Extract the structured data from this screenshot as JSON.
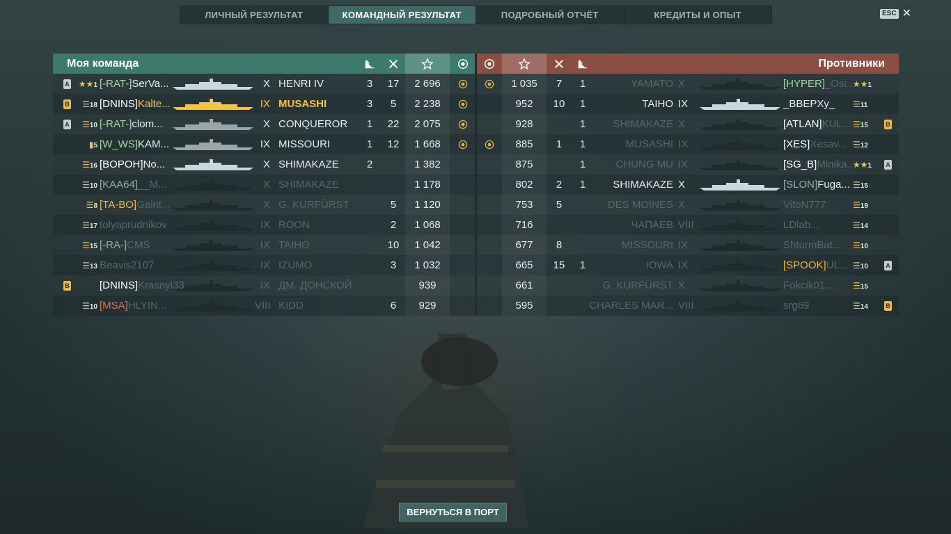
{
  "tabs": [
    {
      "label": "ЛИЧНЫЙ РЕЗУЛЬТАТ",
      "active": false
    },
    {
      "label": "КОМАНДНЫЙ РЕЗУЛЬТАТ",
      "active": true
    },
    {
      "label": "ПОДРОБНЫЙ ОТЧЁТ",
      "active": false
    },
    {
      "label": "КРЕДИТЫ И ОПЫТ",
      "active": false
    }
  ],
  "esc": {
    "key": "ESC",
    "close": "✕"
  },
  "my_team": {
    "title": "Моя команда",
    "rows": [
      {
        "badge": "A",
        "rank": "1",
        "rank_icon": "stars",
        "clan": "[-RAT-]",
        "clan_color": "green",
        "name": "SerVa...",
        "tier": "X",
        "ship": "HENRI IV",
        "kills": "3",
        "planes": "17",
        "xp": "2 696",
        "medal": true,
        "dim": false,
        "sil": "light",
        "hl": false
      },
      {
        "badge": "B",
        "rank": "18",
        "rank_icon": "chevron",
        "clan": "[DNINS]",
        "clan_color": "white",
        "name": "Kalte...",
        "tier": "IX",
        "ship": "MUSASHI",
        "kills": "3",
        "planes": "5",
        "xp": "2 238",
        "medal": true,
        "dim": false,
        "sil": "gold",
        "hl": true
      },
      {
        "badge": "A",
        "rank": "10",
        "rank_icon": "chevron",
        "clan": "[-RAT-]",
        "clan_color": "green",
        "name": "clom...",
        "tier": "X",
        "ship": "CONQUEROR",
        "kills": "1",
        "planes": "22",
        "xp": "2 075",
        "medal": true,
        "dim": false,
        "sil": "grey",
        "hl": false
      },
      {
        "badge": "",
        "rank": "5",
        "rank_icon": "bar",
        "clan": "[W_WS]",
        "clan_color": "green",
        "name": "KAM...",
        "tier": "IX",
        "ship": "MISSOURI",
        "kills": "1",
        "planes": "12",
        "xp": "1 668",
        "medal": true,
        "dim": false,
        "sil": "grey",
        "hl": false
      },
      {
        "badge": "",
        "rank": "16",
        "rank_icon": "chevron",
        "clan": "[BOPOH]",
        "clan_color": "white",
        "name": "No...",
        "tier": "X",
        "ship": "SHIMAKAZE",
        "kills": "2",
        "planes": "",
        "xp": "1 382",
        "medal": false,
        "dim": false,
        "sil": "light",
        "hl": false
      },
      {
        "badge": "",
        "rank": "10",
        "rank_icon": "chevron",
        "clan": "[KAA64]",
        "clan_color": "grey",
        "name": "__M...",
        "tier": "X",
        "ship": "SHIMAKAZE",
        "kills": "",
        "planes": "",
        "xp": "1 178",
        "medal": false,
        "dim": true,
        "sil": "dark",
        "hl": false
      },
      {
        "badge": "",
        "rank": "8",
        "rank_icon": "chevron",
        "clan": "[TA-BO]",
        "clan_color": "orange",
        "name": "Gaint...",
        "tier": "X",
        "ship": "G. KURFÜRST",
        "kills": "",
        "planes": "5",
        "xp": "1 120",
        "medal": false,
        "dim": true,
        "sil": "dark",
        "hl": false
      },
      {
        "badge": "",
        "rank": "17",
        "rank_icon": "chevron",
        "clan": "",
        "clan_color": "grey",
        "name": "tolyaprudnikov",
        "tier": "IX",
        "ship": "ROON",
        "kills": "",
        "planes": "2",
        "xp": "1 068",
        "medal": false,
        "dim": true,
        "sil": "dark",
        "hl": false
      },
      {
        "badge": "",
        "rank": "15",
        "rank_icon": "chevron",
        "clan": "[-RA-]",
        "clan_color": "grey",
        "name": "CMS",
        "tier": "IX",
        "ship": "TAIHO",
        "kills": "",
        "planes": "10",
        "xp": "1 042",
        "medal": false,
        "dim": true,
        "sil": "dark",
        "hl": false
      },
      {
        "badge": "",
        "rank": "13",
        "rank_icon": "chevron",
        "clan": "",
        "clan_color": "grey",
        "name": "Beavis2107",
        "tier": "IX",
        "ship": "IZUMO",
        "kills": "",
        "planes": "3",
        "xp": "1 032",
        "medal": false,
        "dim": true,
        "sil": "dark",
        "hl": false
      },
      {
        "badge": "B",
        "rank": "",
        "rank_icon": "none",
        "clan": "[DNINS]",
        "clan_color": "white",
        "name": "Krasnyi33",
        "tier": "IX",
        "ship": "ДМ. ДОНСКОЙ",
        "kills": "",
        "planes": "",
        "xp": "939",
        "medal": false,
        "dim": true,
        "sil": "dark",
        "hl": false
      },
      {
        "badge": "",
        "rank": "10",
        "rank_icon": "chevron",
        "clan": "[MSA]",
        "clan_color": "red",
        "name": "HLYIN...",
        "tier": "VIII",
        "ship": "KIDD",
        "kills": "",
        "planes": "6",
        "xp": "929",
        "medal": false,
        "dim": true,
        "sil": "dark",
        "hl": false
      }
    ]
  },
  "enemy_team": {
    "title": "Противники",
    "rows": [
      {
        "medal": true,
        "xp": "1 035",
        "planes": "7",
        "kills": "1",
        "ship": "YAMATO",
        "tier": "X",
        "clan": "[HYPER]",
        "clan_color": "green",
        "name": "_Osi...",
        "rank": "1",
        "rank_icon": "stars",
        "badge": "",
        "dim": true,
        "sil": "dark"
      },
      {
        "medal": false,
        "xp": "952",
        "planes": "10",
        "kills": "1",
        "ship": "TAIHO",
        "tier": "IX",
        "clan": "",
        "clan_color": "white",
        "name": "_BBEPXy_",
        "rank": "11",
        "rank_icon": "chevron",
        "badge": "",
        "dim": false,
        "sil": "light"
      },
      {
        "medal": false,
        "xp": "928",
        "planes": "",
        "kills": "1",
        "ship": "SHIMAKAZE",
        "tier": "X",
        "clan": "[ATLAN]",
        "clan_color": "white",
        "name": "KUL...",
        "rank": "15",
        "rank_icon": "chevron",
        "badge": "B",
        "dim": true,
        "sil": "dark"
      },
      {
        "medal": true,
        "xp": "885",
        "planes": "1",
        "kills": "1",
        "ship": "MUSASHI",
        "tier": "IX",
        "clan": "[XES]",
        "clan_color": "white",
        "name": "Xesav...",
        "rank": "12",
        "rank_icon": "chevron",
        "badge": "",
        "dim": true,
        "sil": "dark"
      },
      {
        "medal": false,
        "xp": "875",
        "planes": "",
        "kills": "1",
        "ship": "CHUNG MU",
        "tier": "IX",
        "clan": "[SG_B]",
        "clan_color": "white",
        "name": "Minika...",
        "rank": "1",
        "rank_icon": "stars",
        "badge": "A",
        "dim": true,
        "sil": "dark"
      },
      {
        "medal": false,
        "xp": "802",
        "planes": "2",
        "kills": "1",
        "ship": "SHIMAKAZE",
        "tier": "X",
        "clan": "[SLON]",
        "clan_color": "grey",
        "name": "Fuga...",
        "rank": "15",
        "rank_icon": "chevron",
        "badge": "",
        "dim": false,
        "sil": "light"
      },
      {
        "medal": false,
        "xp": "753",
        "planes": "5",
        "kills": "",
        "ship": "DES MOINES",
        "tier": "X",
        "clan": "",
        "clan_color": "white",
        "name": "VitoN777",
        "rank": "19",
        "rank_icon": "chevron",
        "badge": "",
        "dim": true,
        "sil": "dark"
      },
      {
        "medal": false,
        "xp": "716",
        "planes": "",
        "kills": "",
        "ship": "ЧАПАЕВ",
        "tier": "VIII",
        "clan": "",
        "clan_color": "white",
        "name": "LDlab...",
        "rank": "14",
        "rank_icon": "chevron",
        "badge": "",
        "dim": true,
        "sil": "dark"
      },
      {
        "medal": false,
        "xp": "677",
        "planes": "8",
        "kills": "",
        "ship": "MISSOURI",
        "tier": "IX",
        "clan": "",
        "clan_color": "white",
        "name": "ShturmBat...",
        "rank": "10",
        "rank_icon": "chevron",
        "badge": "",
        "dim": true,
        "sil": "dark"
      },
      {
        "medal": false,
        "xp": "665",
        "planes": "15",
        "kills": "1",
        "ship": "IOWA",
        "tier": "IX",
        "clan": "[SPOOK]",
        "clan_color": "orange",
        "name": "UL...",
        "rank": "10",
        "rank_icon": "chevron",
        "badge": "A",
        "dim": true,
        "sil": "dark"
      },
      {
        "medal": false,
        "xp": "661",
        "planes": "",
        "kills": "",
        "ship": "G. KURFÜRST",
        "tier": "X",
        "clan": "",
        "clan_color": "white",
        "name": "Fokcik01...",
        "rank": "15",
        "rank_icon": "chevron",
        "badge": "",
        "dim": true,
        "sil": "dark"
      },
      {
        "medal": false,
        "xp": "595",
        "planes": "",
        "kills": "",
        "ship": "CHARLES MAR...",
        "tier": "VIII",
        "clan": "",
        "clan_color": "white",
        "name": "srg69",
        "rank": "14",
        "rank_icon": "chevron",
        "badge": "B",
        "dim": true,
        "sil": "dark"
      }
    ]
  },
  "return_button": "ВЕРНУТЬСЯ В ПОРТ",
  "colors": {
    "accent_left": "#3c7a6c",
    "accent_right": "#8a4e42",
    "highlight": "#f5c443"
  }
}
